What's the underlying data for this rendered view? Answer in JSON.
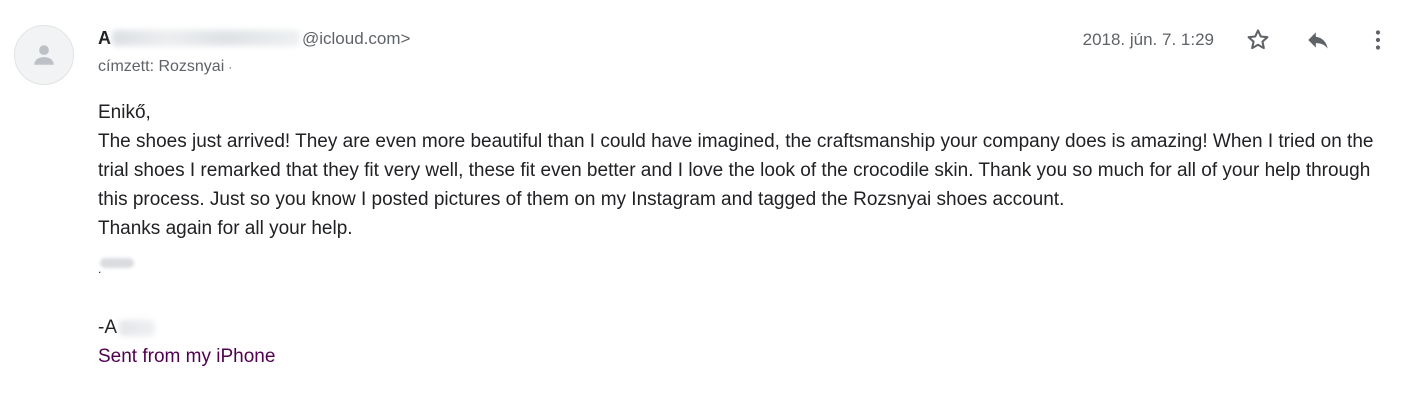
{
  "sender": {
    "initial": "A",
    "domain": "@icloud.com>",
    "avatar_icon": "person-icon"
  },
  "recipient": {
    "text": "címzett: Rozsnyai",
    "dot": "·"
  },
  "meta": {
    "date": "2018. jún. 7. 1:29"
  },
  "actions": {
    "star_icon": "star-outline-icon",
    "reply_icon": "reply-icon",
    "more_icon": "more-vert-icon"
  },
  "body": {
    "greeting": "Enikő,",
    "paragraph": "The shoes just arrived! They are even more beautiful than I could have imagined, the craftsmanship your company does is amazing! When I tried on the trial shoes I remarked that they fit very well, these fit even better and I love the look of the crocodile skin. Thank you so much for all of your help through this process. Just so you know I posted pictures of them on my Instagram and tagged the Rozsnyai shoes account.",
    "thanks": "Thanks again for all your help.",
    "redacted_dot": ".",
    "signoff": "-A",
    "signature": "Sent from my iPhone"
  },
  "colors": {
    "text": "#202124",
    "secondary": "#5f6368",
    "signature": "#500050",
    "avatar_bg": "#f1f3f4"
  }
}
